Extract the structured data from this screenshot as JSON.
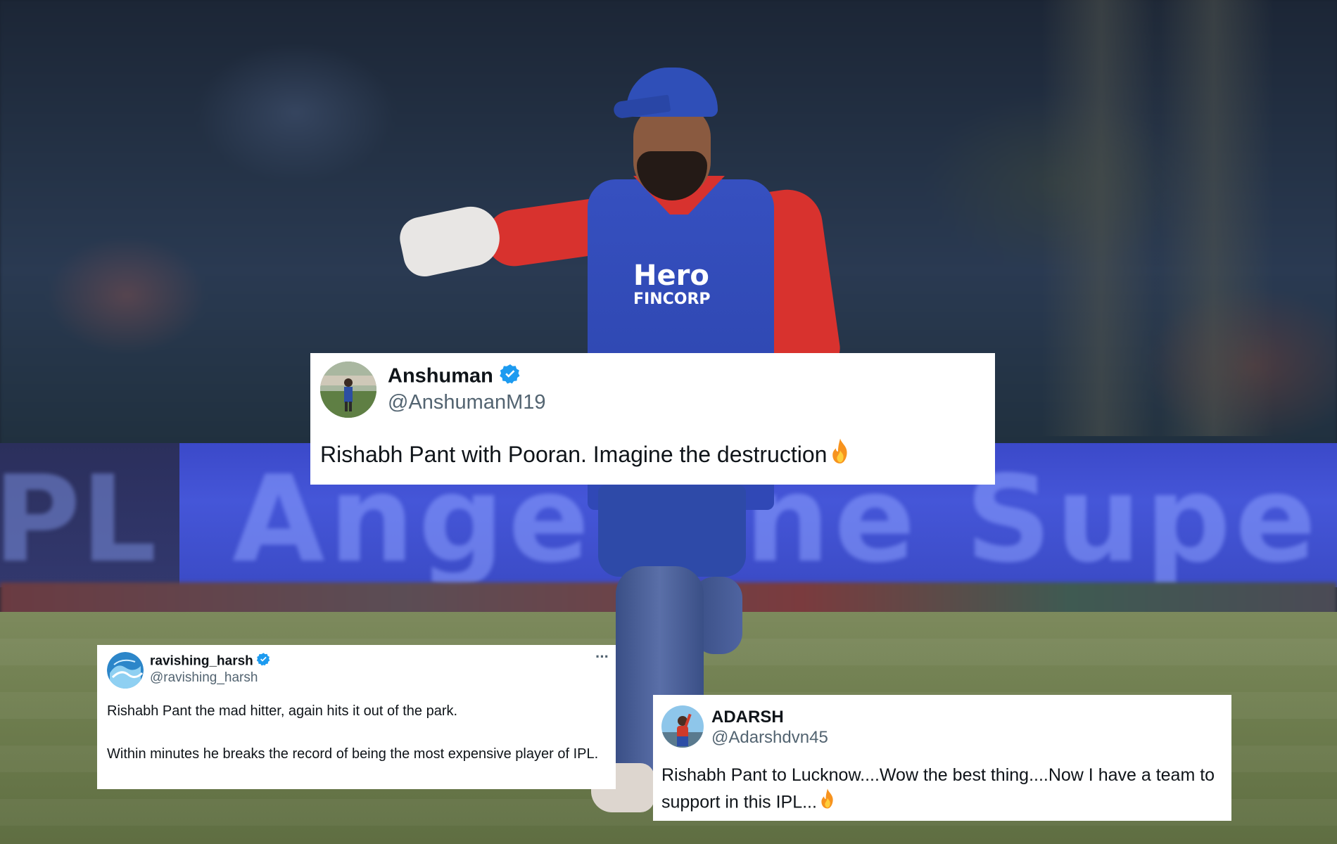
{
  "tweets": [
    {
      "name": "Anshuman",
      "handle": "@AnshumanM19",
      "verified": true,
      "text": "Rishabh Pant with Pooran. Imagine the destruction",
      "emoji": "fire-icon"
    },
    {
      "name": "ravishing_harsh",
      "handle": "@ravishing_harsh",
      "verified": true,
      "more_label": "···",
      "text_line1": "Rishabh Pant the mad hitter, again hits it out of the park.",
      "text_line2": "Within minutes he breaks the record of being the most expensive player of IPL."
    },
    {
      "name": "ADARSH",
      "handle": "@Adarshdvn45",
      "verified": false,
      "text": "Rishabh Pant to Lucknow....Wow the best thing....Now I have a team to support in this IPL...",
      "emoji": "fire-icon"
    }
  ],
  "background": {
    "jersey_sponsor": "Hero",
    "jersey_sponsor_sub": "FINCORP",
    "billboard_text": "AngelOne Supe",
    "billboard_left_text": "PL"
  },
  "colors": {
    "verified_blue": "#1d9bf0",
    "text_primary": "#0f1419",
    "text_secondary": "#536471",
    "card_bg": "#ffffff"
  }
}
